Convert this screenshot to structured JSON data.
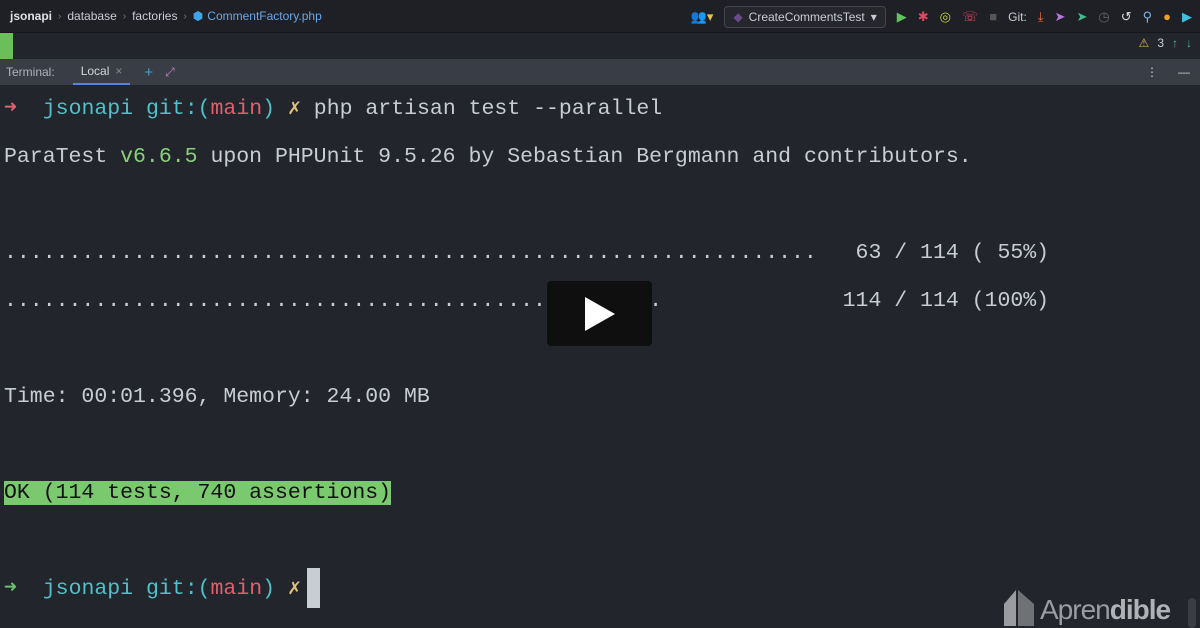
{
  "breadcrumb": {
    "items": [
      "jsonapi",
      "database",
      "factories"
    ],
    "file": "CommentFactory.php"
  },
  "toolbar": {
    "run_config": "CreateCommentsTest",
    "git_label": "Git:"
  },
  "editor": {
    "warning_count": "3"
  },
  "terminal": {
    "title": "Terminal:",
    "tab": "Local",
    "prompt": {
      "dir": "jsonapi",
      "git": "git:(",
      "branch": "main",
      "git_end": ")",
      "dirty": "✗",
      "command": "php artisan test --parallel"
    },
    "banner": {
      "pre": "ParaTest ",
      "version": "v6.6.5",
      "post": " upon PHPUnit 9.5.26 by Sebastian Bergmann and contributors."
    },
    "progress": [
      {
        "dots": "...............................................................",
        "count": "   63 / 114 ( 55%)"
      },
      {
        "dots": "...................................................",
        "count": "              114 / 114 (100%)"
      }
    ],
    "time": "Time: 00:01.396, Memory: 24.00 MB",
    "result": "OK (114 tests, 740 assertions)"
  },
  "watermark": {
    "text_light": "Apren",
    "text_bold": "dible"
  }
}
